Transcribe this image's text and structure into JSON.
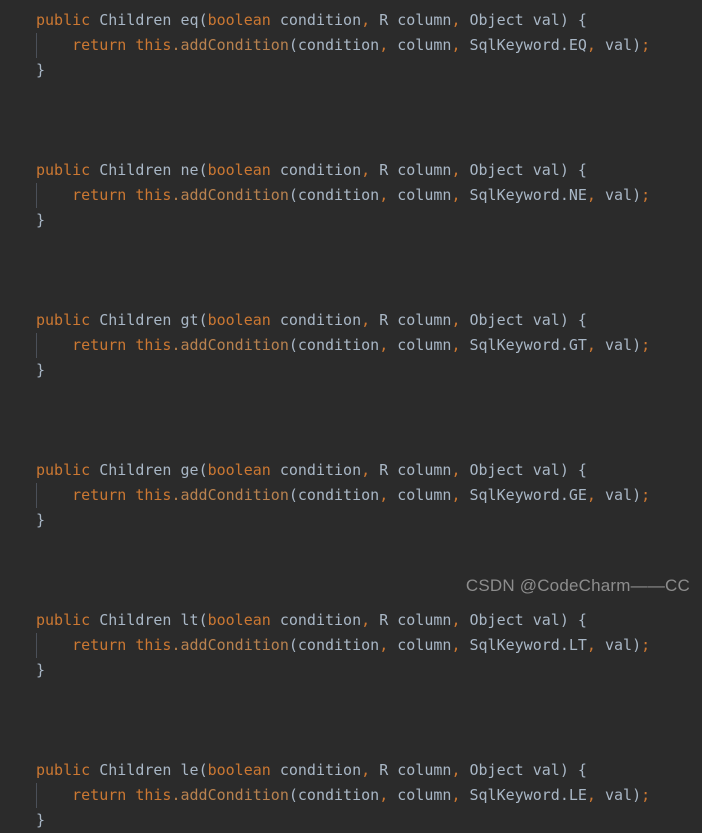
{
  "editor": {
    "background_color": "#2b2b2b",
    "default_text_color": "#a9b7c6",
    "keyword_color": "#cc7832",
    "method_call_color": "#b9824f",
    "indent_guide_color": "#4b5059",
    "language": "java"
  },
  "code": {
    "methods": [
      {
        "modifier": "public",
        "return_type": "Children",
        "name": "eq",
        "params": [
          {
            "type": "boolean",
            "name": "condition"
          },
          {
            "type": "R",
            "name": "column"
          },
          {
            "type": "Object",
            "name": "val"
          }
        ],
        "body_keyword": "return",
        "body_receiver": "this",
        "body_call": "addCondition",
        "body_args": [
          "condition",
          "column",
          "SqlKeyword.EQ",
          "val"
        ],
        "sql_keyword_class": "SqlKeyword",
        "sql_keyword_const": "EQ"
      },
      {
        "modifier": "public",
        "return_type": "Children",
        "name": "ne",
        "params": [
          {
            "type": "boolean",
            "name": "condition"
          },
          {
            "type": "R",
            "name": "column"
          },
          {
            "type": "Object",
            "name": "val"
          }
        ],
        "body_keyword": "return",
        "body_receiver": "this",
        "body_call": "addCondition",
        "body_args": [
          "condition",
          "column",
          "SqlKeyword.NE",
          "val"
        ],
        "sql_keyword_class": "SqlKeyword",
        "sql_keyword_const": "NE"
      },
      {
        "modifier": "public",
        "return_type": "Children",
        "name": "gt",
        "params": [
          {
            "type": "boolean",
            "name": "condition"
          },
          {
            "type": "R",
            "name": "column"
          },
          {
            "type": "Object",
            "name": "val"
          }
        ],
        "body_keyword": "return",
        "body_receiver": "this",
        "body_call": "addCondition",
        "body_args": [
          "condition",
          "column",
          "SqlKeyword.GT",
          "val"
        ],
        "sql_keyword_class": "SqlKeyword",
        "sql_keyword_const": "GT"
      },
      {
        "modifier": "public",
        "return_type": "Children",
        "name": "ge",
        "params": [
          {
            "type": "boolean",
            "name": "condition"
          },
          {
            "type": "R",
            "name": "column"
          },
          {
            "type": "Object",
            "name": "val"
          }
        ],
        "body_keyword": "return",
        "body_receiver": "this",
        "body_call": "addCondition",
        "body_args": [
          "condition",
          "column",
          "SqlKeyword.GE",
          "val"
        ],
        "sql_keyword_class": "SqlKeyword",
        "sql_keyword_const": "GE"
      },
      {
        "modifier": "public",
        "return_type": "Children",
        "name": "lt",
        "params": [
          {
            "type": "boolean",
            "name": "condition"
          },
          {
            "type": "R",
            "name": "column"
          },
          {
            "type": "Object",
            "name": "val"
          }
        ],
        "body_keyword": "return",
        "body_receiver": "this",
        "body_call": "addCondition",
        "body_args": [
          "condition",
          "column",
          "SqlKeyword.LT",
          "val"
        ],
        "sql_keyword_class": "SqlKeyword",
        "sql_keyword_const": "LT"
      },
      {
        "modifier": "public",
        "return_type": "Children",
        "name": "le",
        "params": [
          {
            "type": "boolean",
            "name": "condition"
          },
          {
            "type": "R",
            "name": "column"
          },
          {
            "type": "Object",
            "name": "val"
          }
        ],
        "body_keyword": "return",
        "body_receiver": "this",
        "body_call": "addCondition",
        "body_args": [
          "condition",
          "column",
          "SqlKeyword.LE",
          "val"
        ],
        "sql_keyword_class": "SqlKeyword",
        "sql_keyword_const": "LE"
      }
    ],
    "punctuation": {
      "open_paren": "(",
      "close_paren": ")",
      "open_brace": "{",
      "close_brace": "}",
      "comma": ",",
      "comma_space": ", ",
      "space": " ",
      "dot": ".",
      "semicolon": ";"
    }
  },
  "watermark": {
    "text": "CSDN @CodeCharm——CC"
  }
}
